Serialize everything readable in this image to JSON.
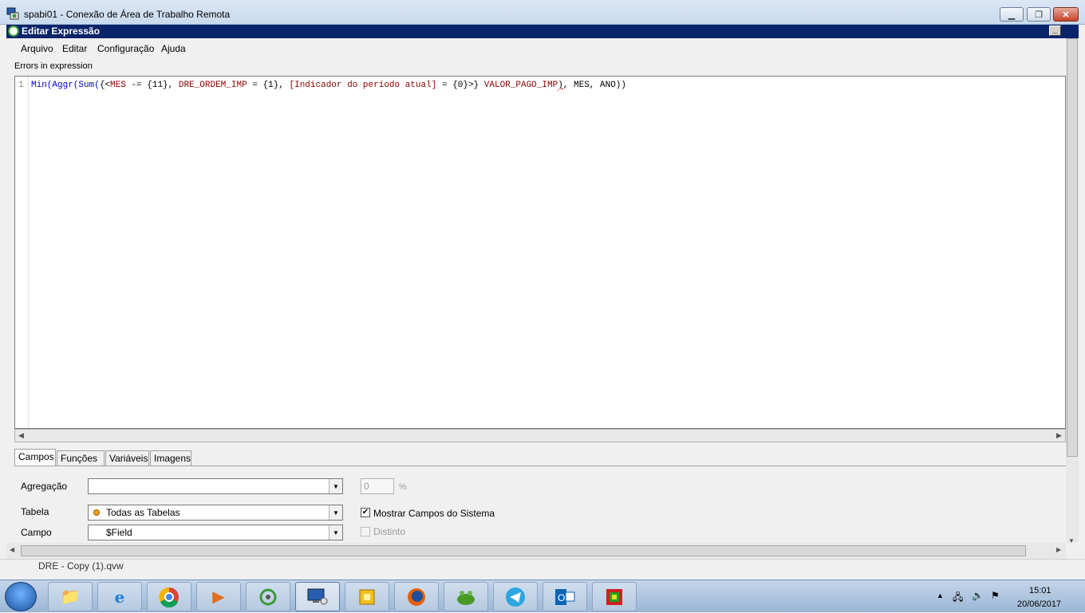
{
  "rdp_window": {
    "title": "spabi01 - Conexão de Área de Trabalho Remota",
    "min": "▭",
    "max": "□",
    "close": "✕"
  },
  "dialog": {
    "title": "Editar Expressão",
    "menu": [
      "Arquivo",
      "Editar",
      "Configuração",
      "Ajuda"
    ],
    "errors_label": "Errors in expression",
    "editor": {
      "line_number": "1",
      "tokens": {
        "t1": "Min(",
        "t2": "Aggr(",
        "t3": "Sum(",
        "t4": "{<",
        "t5": "MES",
        "t6": " -= {11}, ",
        "t7": "DRE_ORDEM_IMP",
        "t8": " = {1}, ",
        "t9": "[Indicador do período atual]",
        "t10": " = {0}",
        "t11": ">} ",
        "t12": "VALOR_PAGO_IMP",
        "t13": ")",
        "t14": ", MES, ANO))"
      }
    },
    "tabs": [
      "Campos",
      "Funções",
      "Variáveis",
      "Imagens"
    ],
    "fields_panel": {
      "agregacao_label": "Agregação",
      "agregacao_value": "",
      "percent_value": "0",
      "percent_sign": "%",
      "tabela_label": "Tabela",
      "tabela_value": "Todas as Tabelas",
      "campo_label": "Campo",
      "campo_value": "$Field",
      "mostrar_campos_label": "Mostrar Campos do Sistema",
      "mostrar_campos_checked": true,
      "distinto_label": "Distinto",
      "distinto_checked": false
    }
  },
  "background": {
    "file_label": "DRE - Copy (1).qvw"
  },
  "taskbar": {
    "apps": [
      {
        "name": "explorer",
        "icon": "folder-icon"
      },
      {
        "name": "ie",
        "icon": "internet-explorer-icon"
      },
      {
        "name": "chrome",
        "icon": "chrome-icon"
      },
      {
        "name": "media",
        "icon": "media-player-icon"
      },
      {
        "name": "qlikview",
        "icon": "qlikview-icon"
      },
      {
        "name": "rdp",
        "icon": "remote-desktop-icon"
      },
      {
        "name": "app7",
        "icon": "chip-icon"
      },
      {
        "name": "firefox",
        "icon": "firefox-icon"
      },
      {
        "name": "frog",
        "icon": "frog-icon"
      },
      {
        "name": "telegram",
        "icon": "telegram-icon"
      },
      {
        "name": "outlook",
        "icon": "outlook-icon"
      },
      {
        "name": "paint",
        "icon": "palette-icon"
      }
    ],
    "time": "15:01",
    "date": "20/06/2017"
  }
}
